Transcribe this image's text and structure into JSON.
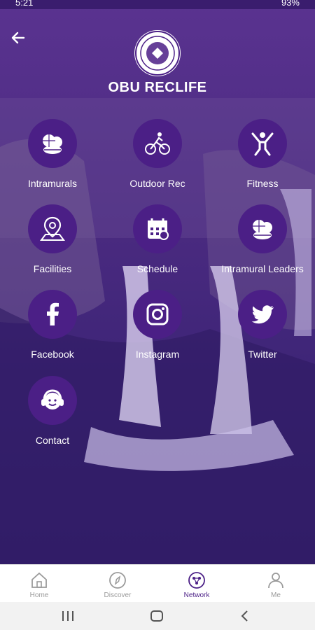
{
  "status_bar": {
    "time": "5:21",
    "battery": "93%"
  },
  "app_title": "OBU RECLIFE",
  "grid": [
    {
      "label": "Intramurals",
      "icon": "sports-balls-icon"
    },
    {
      "label": "Outdoor Rec",
      "icon": "bicycle-icon"
    },
    {
      "label": "Fitness",
      "icon": "fitness-figure-icon"
    },
    {
      "label": "Facilities",
      "icon": "map-pin-icon"
    },
    {
      "label": "Schedule",
      "icon": "calendar-icon"
    },
    {
      "label": "Intramural Leaders",
      "icon": "sports-balls-icon"
    },
    {
      "label": "Facebook",
      "icon": "facebook-icon"
    },
    {
      "label": "Instagram",
      "icon": "instagram-icon"
    },
    {
      "label": "Twitter",
      "icon": "twitter-icon"
    },
    {
      "label": "Contact",
      "icon": "headset-person-icon"
    }
  ],
  "tabs": [
    {
      "label": "Home",
      "icon": "home-icon"
    },
    {
      "label": "Discover",
      "icon": "compass-icon"
    },
    {
      "label": "Network",
      "icon": "network-icon",
      "active": true
    },
    {
      "label": "Me",
      "icon": "person-icon"
    }
  ],
  "colors": {
    "accent": "#4b1f86",
    "overlay": "#5a3390"
  }
}
